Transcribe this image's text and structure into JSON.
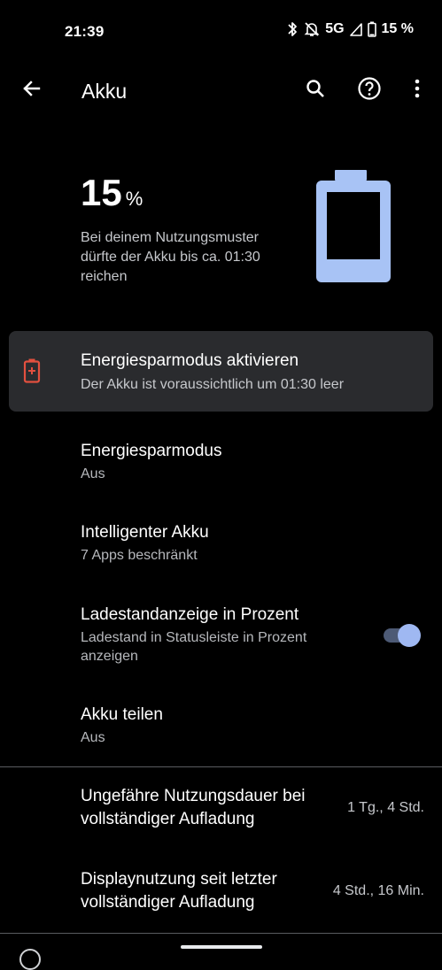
{
  "status_bar": {
    "time": "21:39",
    "network": "5G",
    "battery": "15 %",
    "icons": [
      "bluetooth-icon",
      "notifications-off-icon",
      "signal-icon",
      "battery-icon"
    ]
  },
  "app_bar": {
    "title": "Akku",
    "icons": [
      "back-arrow-icon",
      "search-icon",
      "help-icon",
      "more-vert-icon"
    ]
  },
  "battery": {
    "level_percent": 15,
    "percent_value": "15",
    "percent_unit": "%",
    "estimate": "Bei deinem Nutzungsmuster dürfte der Akku bis ca. 01:30 reichen",
    "graphic_color": "#a8c3f5"
  },
  "tip": {
    "title": "Energiesparmodus aktivieren",
    "summary": "Der Akku ist voraussichtlich um 01:30 leer",
    "icon": "battery-alert-icon",
    "icon_color": "#e2503f"
  },
  "preferences": {
    "battery_saver": {
      "title": "Energiesparmodus",
      "summary": "Aus"
    },
    "adaptive_battery": {
      "title": "Intelligenter Akku",
      "summary": "7 Apps beschränkt"
    },
    "battery_percentage": {
      "title": "Ladestandanzeige in Prozent",
      "summary": "Ladestand in Statusleiste in Prozent anzeigen",
      "enabled": true
    },
    "battery_share": {
      "title": "Akku teilen",
      "summary": "Aus"
    }
  },
  "usage": {
    "full_charge_duration": {
      "label": "Ungefähre Nutzungsdauer bei vollständiger Aufladung",
      "value": "1 Tg., 4 Std."
    },
    "screen_usage": {
      "label": "Displaynutzung seit letzter vollständiger Aufladung",
      "value": "4 Std., 16 Min."
    }
  },
  "colors": {
    "background": "#000000",
    "card": "#2a2b2e",
    "accent": "#9fb8f2"
  }
}
